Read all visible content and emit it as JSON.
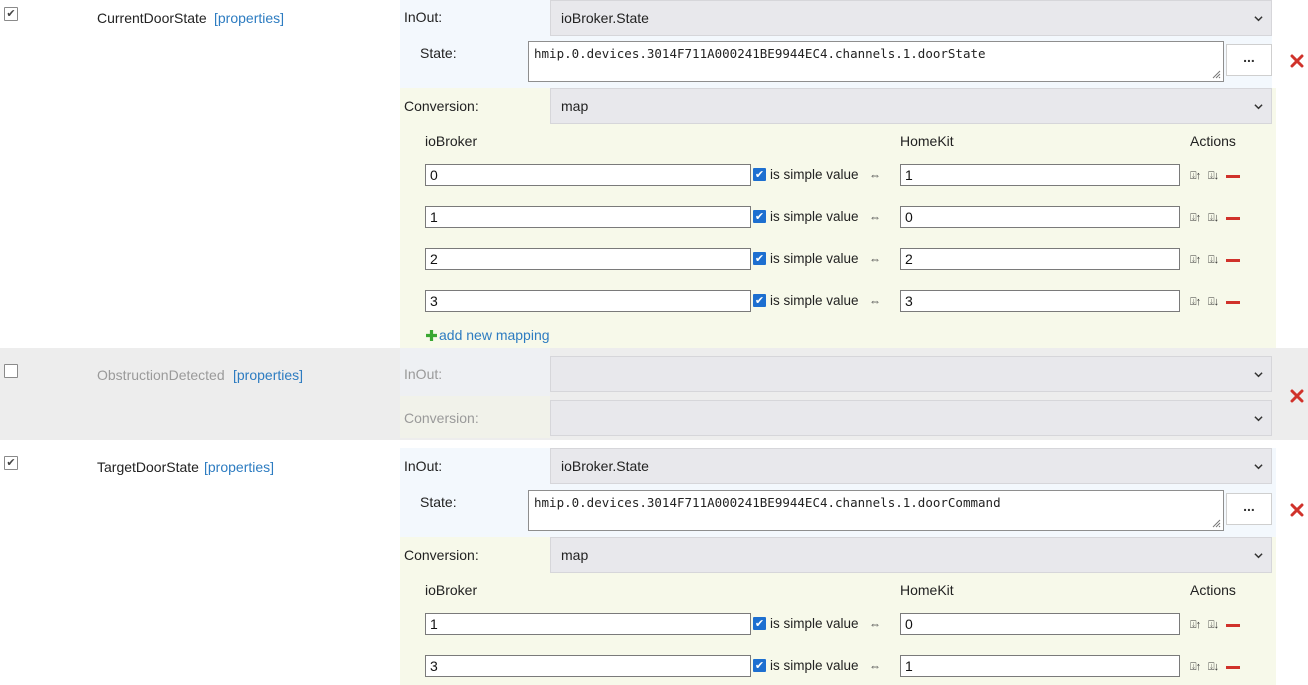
{
  "characteristics": [
    {
      "name": "CurrentDoorState",
      "properties_link": "[properties]",
      "enabled": true,
      "inout_label": "InOut:",
      "inout_value": "ioBroker.State",
      "state_label": "State:",
      "state_value": "hmip.0.devices.3014F711A000241BE9944EC4.channels.1.doorState",
      "browse_button": "...",
      "conversion_label": "Conversion:",
      "conversion_value": "map",
      "col_iobroker": "ioBroker",
      "col_homekit": "HomeKit",
      "col_actions": "Actions",
      "mappings": [
        {
          "iobroker": "0",
          "simple": "is simple value",
          "homekit": "1"
        },
        {
          "iobroker": "1",
          "simple": "is simple value",
          "homekit": "0"
        },
        {
          "iobroker": "2",
          "simple": "is simple value",
          "homekit": "2"
        },
        {
          "iobroker": "3",
          "simple": "is simple value",
          "homekit": "3"
        }
      ],
      "add_mapping": "add new mapping"
    },
    {
      "name": "ObstructionDetected",
      "properties_link": "[properties]",
      "enabled": false,
      "inout_label": "InOut:",
      "inout_value": "",
      "conversion_label": "Conversion:",
      "conversion_value": ""
    },
    {
      "name": "TargetDoorState",
      "properties_link": "[properties]",
      "enabled": true,
      "inout_label": "InOut:",
      "inout_value": "ioBroker.State",
      "state_label": "State:",
      "state_value": "hmip.0.devices.3014F711A000241BE9944EC4.channels.1.doorCommand",
      "browse_button": "...",
      "conversion_label": "Conversion:",
      "conversion_value": "map",
      "col_iobroker": "ioBroker",
      "col_homekit": "HomeKit",
      "col_actions": "Actions",
      "mappings": [
        {
          "iobroker": "1",
          "simple": "is simple value",
          "homekit": "0"
        },
        {
          "iobroker": "3",
          "simple": "is simple value",
          "homekit": "1"
        }
      ]
    }
  ],
  "symbols": {
    "check": "✔",
    "swap_arrow": "⇔",
    "move_up": "⍗↑",
    "move_down": "⍗↓"
  },
  "colors": {
    "remove_red": "#d0322b",
    "add_green": "#3aa832",
    "select_bg": "#e8e8ec",
    "inout_bg": "#f3f8fd",
    "conversion_bg": "#f7f9ea",
    "disabled_row_bg": "#ededed",
    "checkbox_blue": "#1d6fd0",
    "link_blue": "#2d7cc1"
  }
}
